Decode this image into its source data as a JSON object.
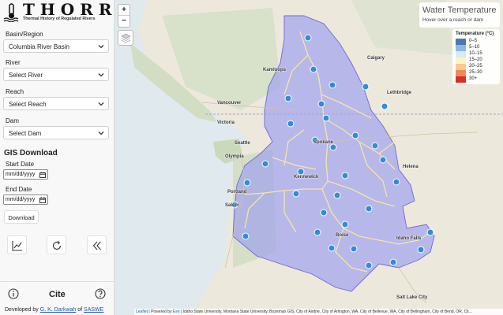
{
  "app": {
    "title": "THORR",
    "subtitle": "Thermal History of Regulated Rivers"
  },
  "filters": {
    "basin_label": "Basin/Region",
    "basin_value": "Columbia River Basin",
    "river_label": "River",
    "river_value": "Select River",
    "reach_label": "Reach",
    "reach_value": "Select Reach",
    "dam_label": "Dam",
    "dam_value": "Select Dam"
  },
  "gis": {
    "title": "GIS Download",
    "start_label": "Start Date",
    "start_placeholder": "mm/dd/yyyy",
    "end_label": "End Date",
    "end_placeholder": "mm/dd/yyyy",
    "download_label": "Download"
  },
  "tools": {
    "chart_icon": "line-chart-icon",
    "refresh_icon": "refresh-icon",
    "collapse_icon": "double-chevron-left-icon"
  },
  "footer": {
    "info_icon": "info-icon",
    "cite_label": "Cite",
    "help_icon": "help-icon",
    "dev_prefix": "Developed by",
    "dev_author": "G. K. Darkwah",
    "dev_of": "of",
    "dev_org": "SASWE"
  },
  "map": {
    "zoom_in": "+",
    "zoom_out": "−",
    "layers_icon": "layers-icon",
    "info_title": "Water Temperature",
    "info_sub": "Hover over a reach or dam",
    "legend_title": "Temperature (°C)",
    "legend": [
      {
        "label": "0–5",
        "color": "#4a78b5"
      },
      {
        "label": "5–10",
        "color": "#8fb8de"
      },
      {
        "label": "10–15",
        "color": "#d6ebf5"
      },
      {
        "label": "15–20",
        "color": "#fbf6c4"
      },
      {
        "label": "20–25",
        "color": "#f9c890"
      },
      {
        "label": "25–30",
        "color": "#f08a5c"
      },
      {
        "label": "30+",
        "color": "#d73027"
      }
    ],
    "places": {
      "calgary": "Calgary",
      "lethbridge": "Lethbridge",
      "kamloops": "Kamloops",
      "vancouver": "Vancouver",
      "victoria": "Victoria",
      "seattle": "Seattle",
      "olympia": "Olympia",
      "spokane": "Spokane",
      "helena": "Helena",
      "kennewick": "Kennewick",
      "portland": "Portland",
      "salem": "Salem",
      "boise": "Boise",
      "idaho_falls": "Idaho Falls",
      "salt_lake_city": "Salt Lake City"
    },
    "attribution": {
      "leaflet": "Leaflet",
      "powered": " | Powered by ",
      "esri": "Esri",
      "rest": " | Idaho State University, Montana State University, Bozeman GIS, City of Airdrie, City of Arlington, WA, City of Bellevue, WA, City of Bellingham, City of Bend, OR, Cit..."
    }
  },
  "colors": {
    "basin_fill": "#9c9cf0",
    "basin_stroke": "#6a6ad8",
    "river": "#f3e6a4",
    "dam_marker": "#2f8fd6"
  }
}
